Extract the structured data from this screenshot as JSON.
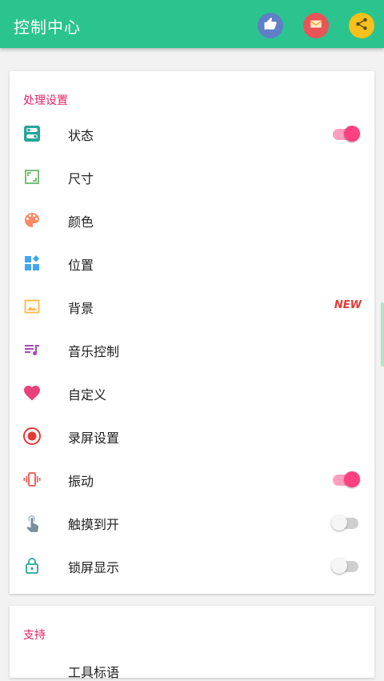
{
  "colors": {
    "appbar": "#2bc48f",
    "accent": "#ff4081",
    "section_header": "#e91e63",
    "toggle_off_track": "#cfcfcf",
    "toggle_off_thumb": "#f5f5f5"
  },
  "appbar": {
    "title": "控制中心",
    "actions": [
      {
        "name": "like",
        "icon": "thumbs-up-icon",
        "bg": "#5f7fc6"
      },
      {
        "name": "mail",
        "icon": "mail-icon",
        "bg": "#e95457"
      },
      {
        "name": "share",
        "icon": "share-icon",
        "bg": "#f5c11a"
      }
    ]
  },
  "sections": [
    {
      "header": "处理设置",
      "items": [
        {
          "label": "状态",
          "icon": "status-toggle-icon",
          "control": "toggle",
          "on": true
        },
        {
          "label": "尺寸",
          "icon": "size-icon"
        },
        {
          "label": "颜色",
          "icon": "palette-icon"
        },
        {
          "label": "位置",
          "icon": "position-widgets-icon"
        },
        {
          "label": "背景",
          "icon": "image-icon",
          "badge": "NEW"
        },
        {
          "label": "音乐控制",
          "icon": "music-playlist-icon"
        },
        {
          "label": "自定义",
          "icon": "heart-icon"
        },
        {
          "label": "录屏设置",
          "icon": "record-icon"
        },
        {
          "label": "振动",
          "icon": "vibration-icon",
          "control": "toggle",
          "on": true
        },
        {
          "label": "触摸到开",
          "icon": "touch-icon",
          "control": "toggle",
          "on": false
        },
        {
          "label": "锁屏显示",
          "icon": "lock-icon",
          "control": "toggle",
          "on": false
        }
      ]
    },
    {
      "header": "支持",
      "items": [
        {
          "label": "工具标语"
        }
      ]
    }
  ]
}
